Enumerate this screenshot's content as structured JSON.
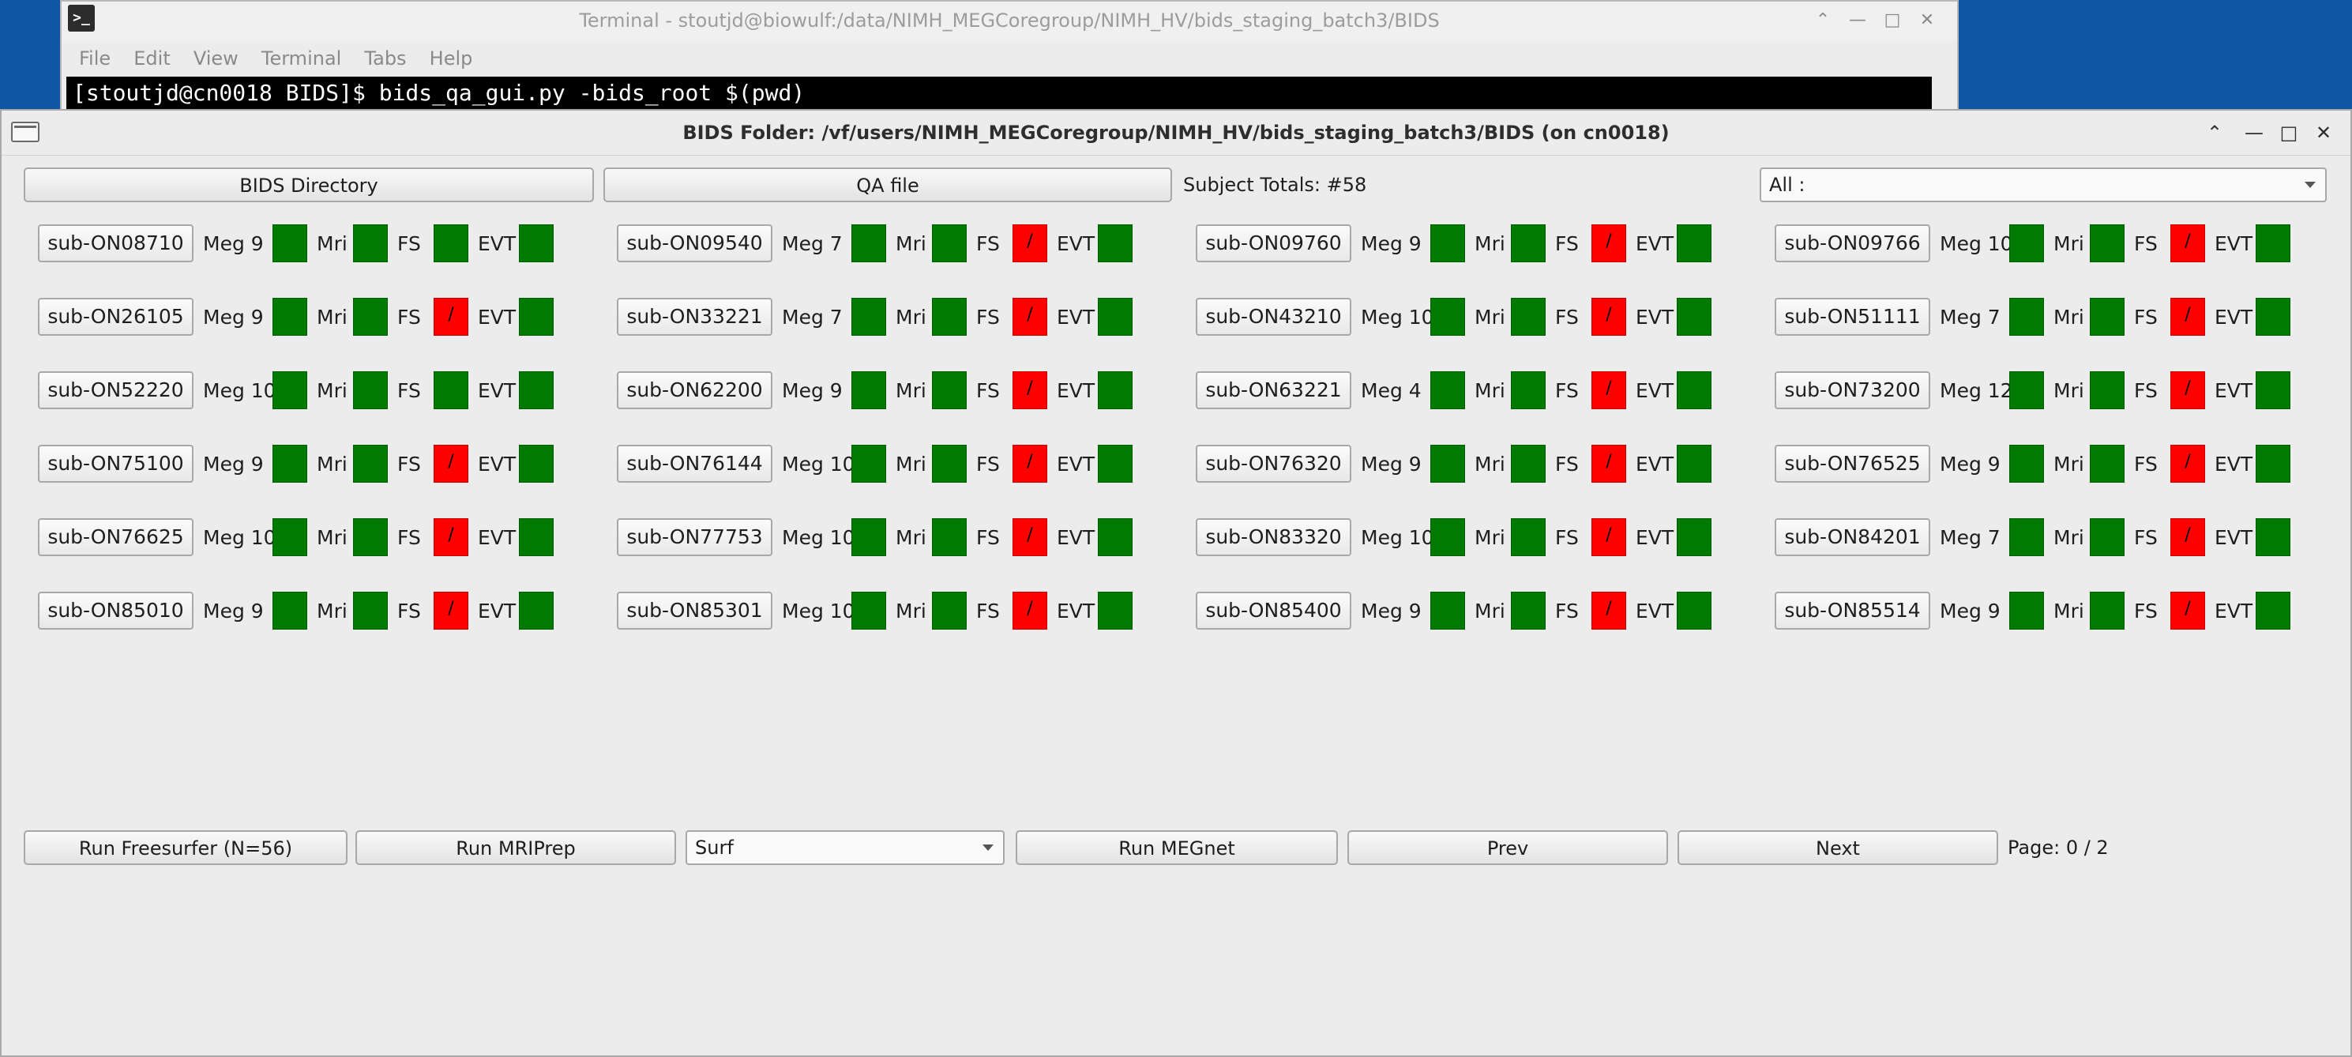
{
  "terminal": {
    "title": "Terminal - stoutjd@biowulf:/data/NIMH_MEGCoregroup/NIMH_HV/bids_staging_batch3/BIDS",
    "icon": "terminal-icon",
    "menu": [
      "File",
      "Edit",
      "View",
      "Terminal",
      "Tabs",
      "Help"
    ],
    "command_line": "[stoutjd@cn0018 BIDS]$ bids_qa_gui.py -bids_root $(pwd)",
    "window_controls": {
      "minimize": "⌃",
      "min2": "—",
      "maximize": "□",
      "close": "✕"
    }
  },
  "window": {
    "title": "BIDS Folder: /vf/users/NIMH_MEGCoregroup/NIMH_HV/bids_staging_batch3/BIDS (on cn0018)",
    "controls": {
      "up": "⌃",
      "minimize": "—",
      "maximize": "□",
      "close": "✕"
    }
  },
  "toolbar": {
    "bids_directory_label": "BIDS Directory",
    "qa_file_label": "QA file",
    "subject_totals": "Subject Totals: #58",
    "filter_value": "All :"
  },
  "colors": {
    "ok": "#007a00",
    "fail": "#ff0000"
  },
  "field_labels": {
    "mri": "Mri",
    "fs": "FS",
    "evt": "EVT"
  },
  "subjects": [
    {
      "id": "sub-ON08710",
      "meg": "Meg 9",
      "meg_ok": true,
      "mri_ok": true,
      "fs_ok": true,
      "evt_ok": true
    },
    {
      "id": "sub-ON09540",
      "meg": "Meg 7",
      "meg_ok": true,
      "mri_ok": true,
      "fs_ok": false,
      "evt_ok": true
    },
    {
      "id": "sub-ON09760",
      "meg": "Meg 9",
      "meg_ok": true,
      "mri_ok": true,
      "fs_ok": false,
      "evt_ok": true
    },
    {
      "id": "sub-ON09766",
      "meg": "Meg 10",
      "meg_ok": true,
      "mri_ok": true,
      "fs_ok": false,
      "evt_ok": true
    },
    {
      "id": "sub-ON26105",
      "meg": "Meg 9",
      "meg_ok": true,
      "mri_ok": true,
      "fs_ok": false,
      "evt_ok": true
    },
    {
      "id": "sub-ON33221",
      "meg": "Meg 7",
      "meg_ok": true,
      "mri_ok": true,
      "fs_ok": false,
      "evt_ok": true
    },
    {
      "id": "sub-ON43210",
      "meg": "Meg 10",
      "meg_ok": true,
      "mri_ok": true,
      "fs_ok": false,
      "evt_ok": true
    },
    {
      "id": "sub-ON51111",
      "meg": "Meg 7",
      "meg_ok": true,
      "mri_ok": true,
      "fs_ok": false,
      "evt_ok": true
    },
    {
      "id": "sub-ON52220",
      "meg": "Meg 10",
      "meg_ok": true,
      "mri_ok": true,
      "fs_ok": true,
      "evt_ok": true
    },
    {
      "id": "sub-ON62200",
      "meg": "Meg 9",
      "meg_ok": true,
      "mri_ok": true,
      "fs_ok": false,
      "evt_ok": true
    },
    {
      "id": "sub-ON63221",
      "meg": "Meg 4",
      "meg_ok": true,
      "mri_ok": true,
      "fs_ok": false,
      "evt_ok": true
    },
    {
      "id": "sub-ON73200",
      "meg": "Meg 12",
      "meg_ok": true,
      "mri_ok": true,
      "fs_ok": false,
      "evt_ok": true
    },
    {
      "id": "sub-ON75100",
      "meg": "Meg 9",
      "meg_ok": true,
      "mri_ok": true,
      "fs_ok": false,
      "evt_ok": true
    },
    {
      "id": "sub-ON76144",
      "meg": "Meg 10",
      "meg_ok": true,
      "mri_ok": true,
      "fs_ok": false,
      "evt_ok": true
    },
    {
      "id": "sub-ON76320",
      "meg": "Meg 9",
      "meg_ok": true,
      "mri_ok": true,
      "fs_ok": false,
      "evt_ok": true
    },
    {
      "id": "sub-ON76525",
      "meg": "Meg 9",
      "meg_ok": true,
      "mri_ok": true,
      "fs_ok": false,
      "evt_ok": true
    },
    {
      "id": "sub-ON76625",
      "meg": "Meg 10",
      "meg_ok": true,
      "mri_ok": true,
      "fs_ok": false,
      "evt_ok": true
    },
    {
      "id": "sub-ON77753",
      "meg": "Meg 10",
      "meg_ok": true,
      "mri_ok": true,
      "fs_ok": false,
      "evt_ok": true
    },
    {
      "id": "sub-ON83320",
      "meg": "Meg 10",
      "meg_ok": true,
      "mri_ok": true,
      "fs_ok": false,
      "evt_ok": true
    },
    {
      "id": "sub-ON84201",
      "meg": "Meg 7",
      "meg_ok": true,
      "mri_ok": true,
      "fs_ok": false,
      "evt_ok": true
    },
    {
      "id": "sub-ON85010",
      "meg": "Meg 9",
      "meg_ok": true,
      "mri_ok": true,
      "fs_ok": false,
      "evt_ok": true
    },
    {
      "id": "sub-ON85301",
      "meg": "Meg 10",
      "meg_ok": true,
      "mri_ok": true,
      "fs_ok": false,
      "evt_ok": true
    },
    {
      "id": "sub-ON85400",
      "meg": "Meg 9",
      "meg_ok": true,
      "mri_ok": true,
      "fs_ok": false,
      "evt_ok": true
    },
    {
      "id": "sub-ON85514",
      "meg": "Meg 9",
      "meg_ok": true,
      "mri_ok": true,
      "fs_ok": false,
      "evt_ok": true
    }
  ],
  "bottom_bar": {
    "run_freesurfer_label": "Run Freesurfer (N=56)",
    "run_mriprep_label": "Run MRIPrep",
    "surf_value": "Surf",
    "run_megnet_label": "Run MEGnet",
    "prev_label": "Prev",
    "next_label": "Next",
    "page_text": "Page: 0 / 2"
  }
}
